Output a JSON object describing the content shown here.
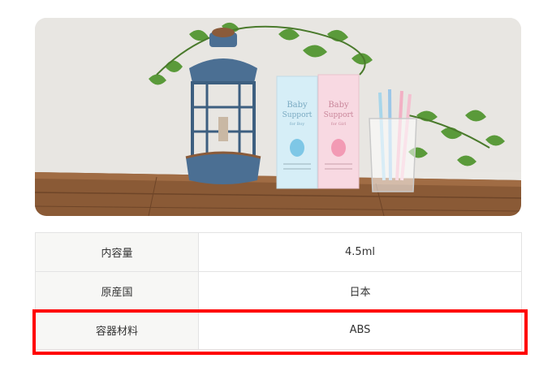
{
  "product_image": {
    "box_left": {
      "brand": "Baby",
      "line": "Support",
      "sub": "for Boy"
    },
    "box_right": {
      "brand": "Baby",
      "line": "Support",
      "sub": "for Girl"
    }
  },
  "spec_rows": [
    {
      "label": "内容量",
      "value": "4.5ml"
    },
    {
      "label": "原産国",
      "value": "日本"
    },
    {
      "label": "容器材料",
      "value": "ABS"
    }
  ],
  "colors": {
    "highlight": "#ff0000",
    "box_blue": "#cfeaf5",
    "box_pink": "#f7d6df",
    "wood": "#8a5a36"
  }
}
